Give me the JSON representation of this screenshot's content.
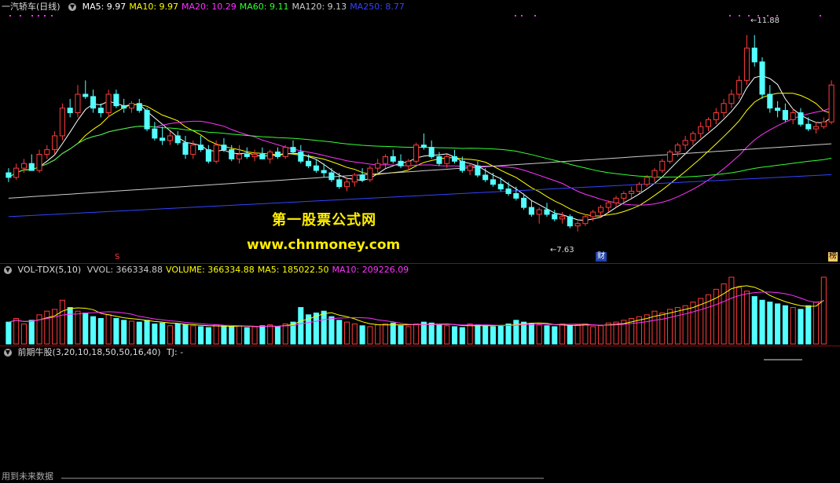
{
  "main": {
    "title": "一汽轿车(日线)",
    "circle_icon": "collapse-icon",
    "ma_labels": [
      {
        "text": "MA5: 9.97",
        "color": "#ffffff"
      },
      {
        "text": "MA10: 9.97",
        "color": "#ffff00"
      },
      {
        "text": "MA20: 10.29",
        "color": "#ff33ff"
      },
      {
        "text": "MA60: 9.11",
        "color": "#33ff33"
      },
      {
        "text": "MA120: 9.13",
        "color": "#cccccc"
      },
      {
        "text": "MA250: 8.77",
        "color": "#3344ff"
      }
    ],
    "high_label": "11.88",
    "low_label": "7.63",
    "marker_s": "S",
    "marker_cai": "财",
    "marker_bang": "榜",
    "watermark_line1": "第一股票公式网",
    "watermark_line2": "www.chnmoney.com",
    "colors": {
      "up": "#ff3b3b",
      "down": "#54ffff",
      "bg": "#000000",
      "grid": "#7a1010"
    }
  },
  "volume": {
    "title": "VOL-TDX(5,10)",
    "labels": [
      {
        "text": "VVOL: 366334.88",
        "color": "#cccccc"
      },
      {
        "text": "VOLUME: 366334.88",
        "color": "#ffff00"
      },
      {
        "text": "MA5: 185022.50",
        "color": "#ffff00"
      },
      {
        "text": "MA10: 209226.09",
        "color": "#ff33ff"
      }
    ]
  },
  "indicator": {
    "title": "前期牛股(3,20,10,18,50,50,16,40)",
    "tj_label": "TJ: -"
  },
  "footer": {
    "label": "用到未来数据"
  },
  "chart_data": {
    "type": "candlestick",
    "price_range": [
      7.2,
      12.3
    ],
    "ohlc": [
      [
        8.9,
        9.0,
        8.7,
        8.8
      ],
      [
        8.8,
        9.1,
        8.75,
        9.0
      ],
      [
        9.0,
        9.2,
        8.9,
        9.1
      ],
      [
        9.1,
        9.3,
        8.95,
        8.95
      ],
      [
        8.95,
        9.4,
        8.9,
        9.3
      ],
      [
        9.3,
        9.5,
        9.2,
        9.4
      ],
      [
        9.4,
        9.8,
        9.3,
        9.7
      ],
      [
        9.7,
        10.4,
        9.6,
        10.3
      ],
      [
        10.3,
        10.5,
        10.1,
        10.2
      ],
      [
        10.2,
        10.8,
        10.1,
        10.6
      ],
      [
        10.6,
        10.9,
        10.5,
        10.55
      ],
      [
        10.55,
        10.7,
        10.2,
        10.3
      ],
      [
        10.3,
        10.4,
        10.1,
        10.2
      ],
      [
        10.2,
        10.7,
        10.1,
        10.6
      ],
      [
        10.6,
        10.7,
        10.3,
        10.35
      ],
      [
        10.35,
        10.5,
        10.2,
        10.3
      ],
      [
        10.3,
        10.45,
        10.2,
        10.4
      ],
      [
        10.4,
        10.5,
        10.2,
        10.25
      ],
      [
        10.25,
        10.3,
        9.8,
        9.85
      ],
      [
        9.85,
        10.0,
        9.6,
        9.65
      ],
      [
        9.65,
        9.9,
        9.5,
        9.6
      ],
      [
        9.6,
        9.8,
        9.5,
        9.7
      ],
      [
        9.7,
        9.8,
        9.5,
        9.55
      ],
      [
        9.55,
        9.7,
        9.2,
        9.3
      ],
      [
        9.3,
        9.6,
        9.2,
        9.5
      ],
      [
        9.5,
        9.7,
        9.35,
        9.4
      ],
      [
        9.4,
        9.5,
        9.1,
        9.15
      ],
      [
        9.15,
        9.6,
        9.1,
        9.5
      ],
      [
        9.5,
        9.65,
        9.35,
        9.4
      ],
      [
        9.4,
        9.5,
        9.15,
        9.2
      ],
      [
        9.2,
        9.5,
        9.1,
        9.3
      ],
      [
        9.3,
        9.45,
        9.2,
        9.25
      ],
      [
        9.25,
        9.4,
        9.15,
        9.3
      ],
      [
        9.3,
        9.45,
        9.2,
        9.2
      ],
      [
        9.2,
        9.4,
        9.1,
        9.35
      ],
      [
        9.35,
        9.45,
        9.2,
        9.25
      ],
      [
        9.25,
        9.5,
        9.2,
        9.45
      ],
      [
        9.45,
        9.6,
        9.3,
        9.35
      ],
      [
        9.35,
        9.5,
        9.1,
        9.15
      ],
      [
        9.15,
        9.3,
        9.0,
        9.05
      ],
      [
        9.05,
        9.2,
        8.9,
        8.95
      ],
      [
        8.95,
        9.1,
        8.8,
        8.9
      ],
      [
        8.9,
        9.0,
        8.7,
        8.75
      ],
      [
        8.75,
        8.9,
        8.55,
        8.6
      ],
      [
        8.6,
        8.8,
        8.5,
        8.7
      ],
      [
        8.7,
        8.9,
        8.6,
        8.85
      ],
      [
        8.85,
        9.0,
        8.7,
        8.75
      ],
      [
        8.75,
        9.05,
        8.7,
        9.0
      ],
      [
        9.0,
        9.2,
        8.9,
        9.1
      ],
      [
        9.1,
        9.3,
        9.0,
        9.25
      ],
      [
        9.25,
        9.4,
        9.1,
        9.15
      ],
      [
        9.15,
        9.3,
        9.0,
        9.05
      ],
      [
        9.05,
        9.2,
        8.95,
        9.15
      ],
      [
        9.15,
        9.55,
        9.1,
        9.5
      ],
      [
        9.5,
        9.75,
        9.4,
        9.45
      ],
      [
        9.45,
        9.6,
        9.2,
        9.25
      ],
      [
        9.25,
        9.35,
        9.05,
        9.1
      ],
      [
        9.1,
        9.3,
        9.0,
        9.25
      ],
      [
        9.25,
        9.4,
        9.1,
        9.15
      ],
      [
        9.15,
        9.25,
        8.9,
        8.95
      ],
      [
        8.95,
        9.1,
        8.85,
        9.05
      ],
      [
        9.05,
        9.15,
        8.8,
        8.85
      ],
      [
        8.85,
        9.0,
        8.7,
        8.75
      ],
      [
        8.75,
        8.9,
        8.6,
        8.65
      ],
      [
        8.65,
        8.8,
        8.5,
        8.55
      ],
      [
        8.55,
        8.7,
        8.4,
        8.45
      ],
      [
        8.45,
        8.6,
        8.3,
        8.35
      ],
      [
        8.35,
        8.45,
        8.1,
        8.15
      ],
      [
        8.15,
        8.3,
        7.95,
        8.0
      ],
      [
        8.0,
        8.15,
        7.8,
        8.1
      ],
      [
        8.1,
        8.25,
        7.95,
        8.0
      ],
      [
        8.0,
        8.1,
        7.85,
        7.9
      ],
      [
        7.9,
        8.05,
        7.8,
        7.95
      ],
      [
        7.95,
        8.0,
        7.7,
        7.75
      ],
      [
        7.75,
        7.85,
        7.63,
        7.8
      ],
      [
        7.8,
        8.0,
        7.75,
        7.95
      ],
      [
        7.95,
        8.1,
        7.85,
        8.05
      ],
      [
        8.05,
        8.2,
        7.95,
        8.15
      ],
      [
        8.15,
        8.3,
        8.05,
        8.25
      ],
      [
        8.25,
        8.4,
        8.15,
        8.35
      ],
      [
        8.35,
        8.5,
        8.25,
        8.45
      ],
      [
        8.45,
        8.6,
        8.35,
        8.5
      ],
      [
        8.5,
        8.7,
        8.45,
        8.65
      ],
      [
        8.65,
        8.85,
        8.6,
        8.8
      ],
      [
        8.8,
        9.0,
        8.7,
        8.95
      ],
      [
        8.95,
        9.2,
        8.9,
        9.15
      ],
      [
        9.15,
        9.4,
        9.1,
        9.35
      ],
      [
        9.35,
        9.55,
        9.25,
        9.5
      ],
      [
        9.5,
        9.7,
        9.4,
        9.6
      ],
      [
        9.6,
        9.8,
        9.5,
        9.75
      ],
      [
        9.75,
        10.0,
        9.65,
        9.9
      ],
      [
        9.9,
        10.1,
        9.8,
        10.05
      ],
      [
        10.05,
        10.3,
        9.95,
        10.2
      ],
      [
        10.2,
        10.5,
        10.1,
        10.4
      ],
      [
        10.4,
        10.7,
        10.3,
        10.6
      ],
      [
        10.6,
        11.0,
        10.5,
        10.9
      ],
      [
        10.9,
        11.88,
        10.8,
        11.6
      ],
      [
        11.6,
        11.88,
        11.2,
        11.3
      ],
      [
        11.3,
        11.4,
        10.5,
        10.6
      ],
      [
        10.6,
        10.8,
        10.2,
        10.3
      ],
      [
        10.3,
        10.45,
        10.1,
        10.25
      ],
      [
        10.25,
        10.4,
        10.0,
        10.05
      ],
      [
        10.05,
        10.3,
        9.95,
        10.2
      ],
      [
        10.2,
        10.3,
        9.9,
        9.95
      ],
      [
        9.95,
        10.1,
        9.8,
        9.85
      ],
      [
        9.85,
        10.0,
        9.75,
        9.9
      ],
      [
        9.9,
        10.1,
        9.85,
        10.0
      ],
      [
        10.0,
        10.9,
        9.95,
        10.8
      ]
    ],
    "volume": [
      120,
      140,
      110,
      130,
      160,
      180,
      190,
      240,
      200,
      180,
      170,
      150,
      140,
      160,
      140,
      130,
      125,
      120,
      130,
      110,
      115,
      100,
      110,
      105,
      100,
      95,
      90,
      105,
      100,
      95,
      100,
      90,
      95,
      100,
      105,
      95,
      110,
      120,
      200,
      160,
      170,
      180,
      150,
      130,
      120,
      110,
      100,
      95,
      105,
      110,
      115,
      100,
      95,
      110,
      120,
      115,
      105,
      100,
      95,
      90,
      110,
      105,
      100,
      95,
      100,
      110,
      130,
      120,
      110,
      105,
      100,
      95,
      110,
      100,
      105,
      110,
      95,
      100,
      115,
      120,
      130,
      140,
      150,
      160,
      180,
      170,
      190,
      200,
      210,
      230,
      250,
      270,
      300,
      330,
      366,
      310,
      290,
      260,
      240,
      230,
      220,
      210,
      200,
      190,
      210,
      230,
      366
    ]
  }
}
